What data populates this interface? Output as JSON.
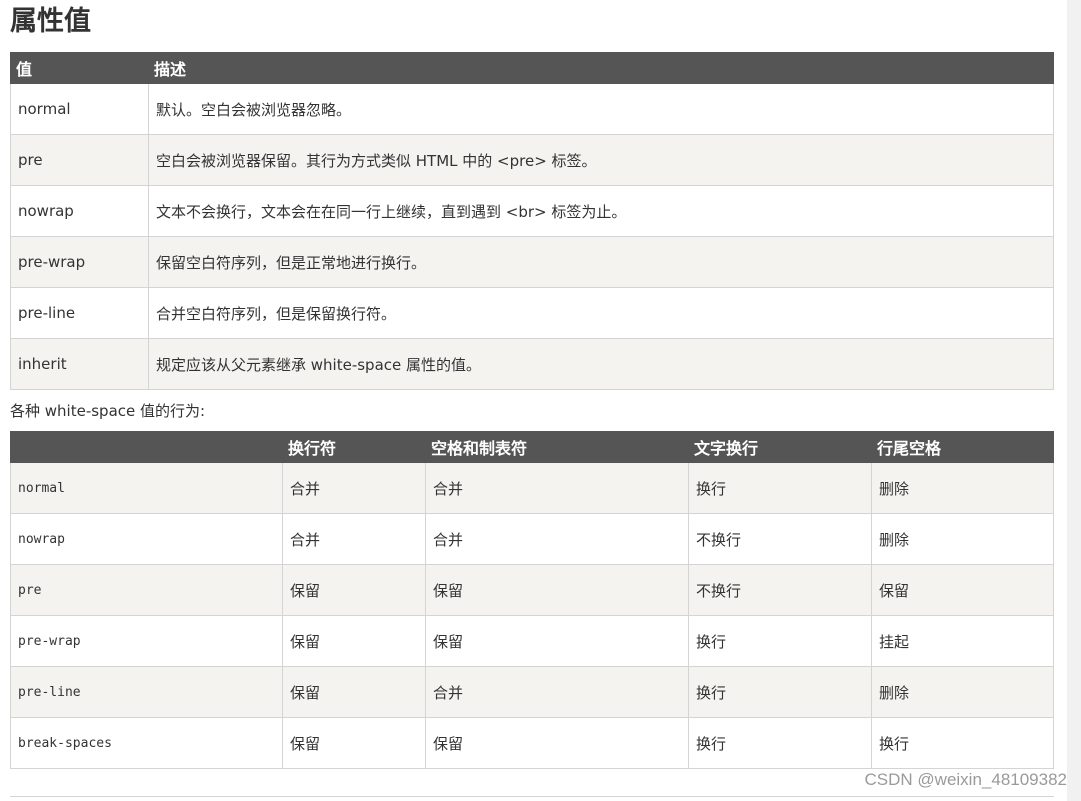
{
  "title": "属性值",
  "values_table": {
    "headers": [
      "值",
      "描述"
    ],
    "rows": [
      {
        "value": "normal",
        "desc": "默认。空白会被浏览器忽略。"
      },
      {
        "value": "pre",
        "desc": "空白会被浏览器保留。其行为方式类似 HTML 中的 <pre> 标签。"
      },
      {
        "value": "nowrap",
        "desc": "文本不会换行，文本会在在同一行上继续，直到遇到 <br> 标签为止。"
      },
      {
        "value": "pre-wrap",
        "desc": "保留空白符序列，但是正常地进行换行。"
      },
      {
        "value": "pre-line",
        "desc": "合并空白符序列，但是保留换行符。"
      },
      {
        "value": "inherit",
        "desc": "规定应该从父元素继承 white-space 属性的值。"
      }
    ]
  },
  "behavior_caption": "各种 white-space 值的行为:",
  "behavior_table": {
    "headers": [
      "",
      "换行符",
      "空格和制表符",
      "文字换行",
      "行尾空格"
    ],
    "rows": [
      [
        "normal",
        "合并",
        "合并",
        "换行",
        "删除"
      ],
      [
        "nowrap",
        "合并",
        "合并",
        "不换行",
        "删除"
      ],
      [
        "pre",
        "保留",
        "保留",
        "不换行",
        "保留"
      ],
      [
        "pre-wrap",
        "保留",
        "保留",
        "换行",
        "挂起"
      ],
      [
        "pre-line",
        "保留",
        "合并",
        "换行",
        "删除"
      ],
      [
        "break-spaces",
        "保留",
        "保留",
        "换行",
        "换行"
      ]
    ]
  },
  "watermark": "CSDN @weixin_48109382"
}
